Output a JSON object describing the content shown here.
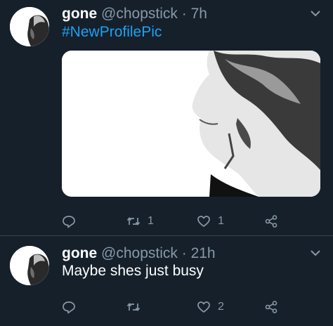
{
  "tweets": [
    {
      "name": "gone",
      "handle": "@chopstick",
      "separator": "·",
      "time": "7h",
      "text": "#NewProfilePic",
      "actions": {
        "reply_count": "",
        "retweet_count": "1",
        "like_count": "1"
      }
    },
    {
      "name": "gone",
      "handle": "@chopstick",
      "separator": "·",
      "time": "21h",
      "text": "Maybe shes just busy",
      "actions": {
        "reply_count": "",
        "retweet_count": "",
        "like_count": "2"
      }
    }
  ],
  "colors": {
    "background": "#15202b",
    "divider": "#38444d",
    "secondary_text": "#8899a6",
    "link": "#1da1f2"
  },
  "icons": [
    "reply-icon",
    "retweet-icon",
    "like-icon",
    "share-icon",
    "chevron-down-icon"
  ]
}
